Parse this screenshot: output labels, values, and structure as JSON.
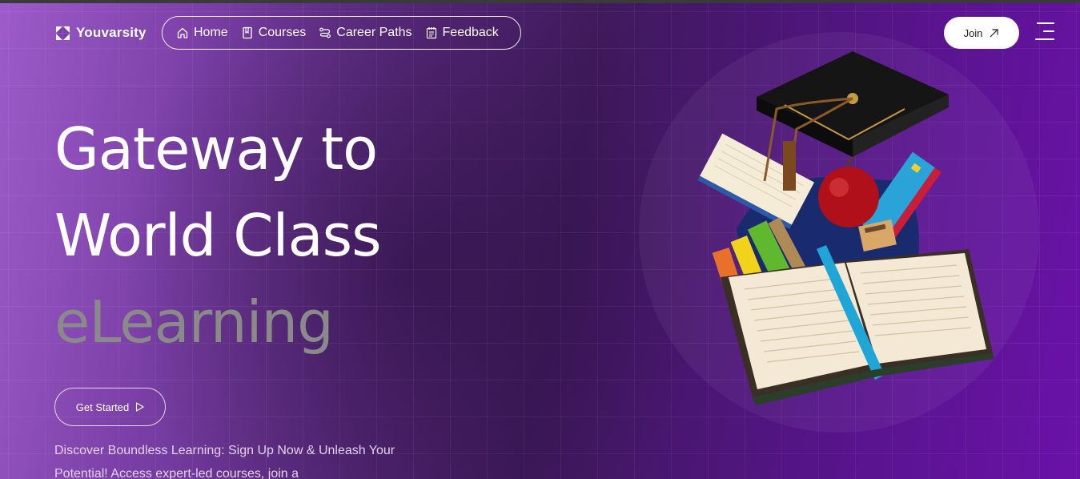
{
  "brand": {
    "name": "Youvarsity",
    "icon": "pinwheel-logo-icon"
  },
  "nav": {
    "items": [
      {
        "label": "Home",
        "icon": "home-icon"
      },
      {
        "label": "Courses",
        "icon": "bookmark-icon"
      },
      {
        "label": "Career Paths",
        "icon": "route-icon"
      },
      {
        "label": "Feedback",
        "icon": "notepad-icon"
      }
    ]
  },
  "header": {
    "join_label": "Join",
    "join_icon": "arrow-up-right-icon",
    "menu_icon": "hamburger-menu-icon"
  },
  "hero": {
    "headline_line1": "Gateway to",
    "headline_line2": "World Class",
    "headline_line3": "eLearning",
    "cta_label": "Get Started",
    "cta_icon": "play-triangle-icon",
    "description": "Discover Boundless Learning: Sign Up Now & Unleash Your Potential! Access expert-led courses, join a",
    "illustration": "graduation-cap-books-apple-illustration"
  },
  "colors": {
    "bg_left": "#9d5cc9",
    "bg_mid": "#3f1a5c",
    "bg_right": "#6a12a8",
    "headline_white": "#ffffff",
    "headline_gray": "#8a8a8a",
    "join_bg": "#ffffff"
  }
}
